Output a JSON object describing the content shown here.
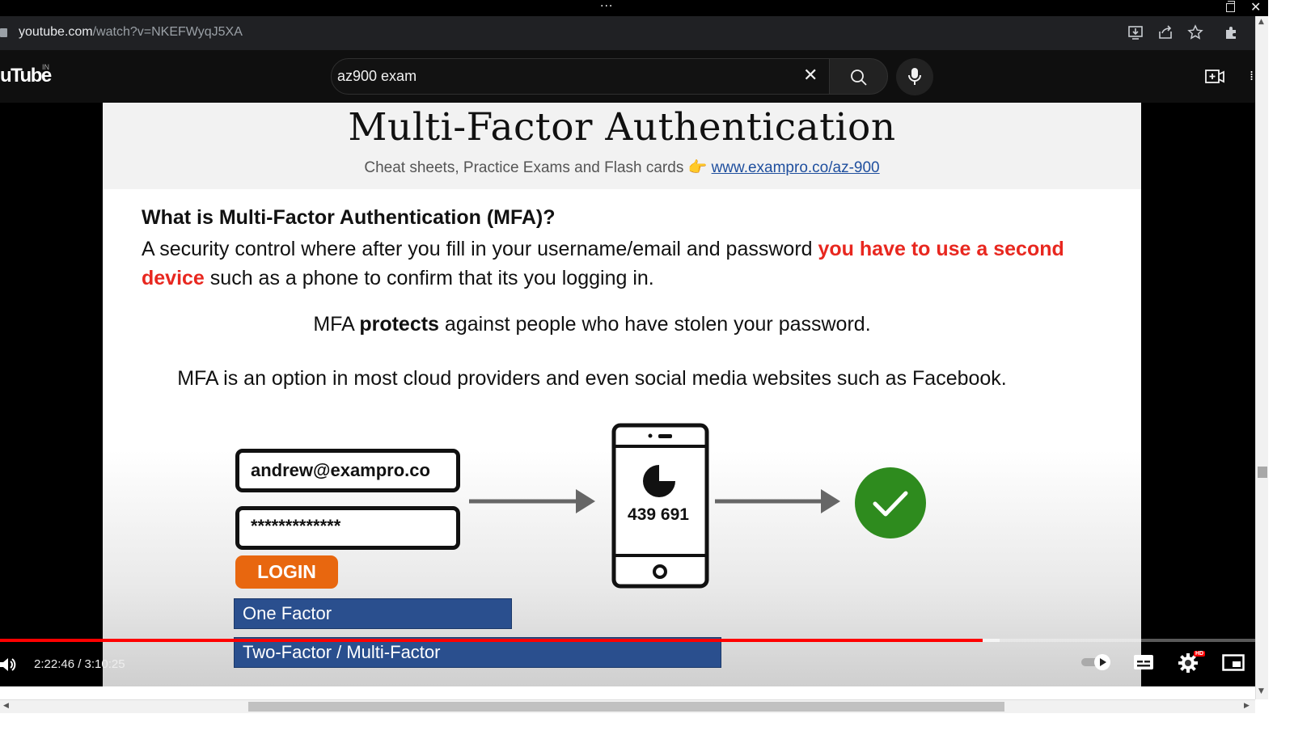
{
  "window": {
    "menu_glyph": "···",
    "close_glyph": "✕"
  },
  "address_bar": {
    "url_host": "youtube.com",
    "url_path": "/watch?v=NKEFWyqJ5XA",
    "icons": [
      "lock-icon",
      "install-icon",
      "share-icon",
      "bookmark-star-icon",
      "extensions-icon"
    ]
  },
  "yt_header": {
    "logo_text": "uTube",
    "region": "IN",
    "search_value": "az900 exam",
    "clear_glyph": "✕",
    "more_glyph": "⁞"
  },
  "slide": {
    "title": "Multi-Factor Authentication",
    "subtitle_text": "Cheat sheets, Practice Exams and Flash cards",
    "subtitle_pointer": "👉",
    "subtitle_link": "www.exampro.co/az-900",
    "question_heading": "What is Multi-Factor Authentication (MFA)?",
    "body_part1": "A security control where after you fill in your username/email and password ",
    "body_red": "you have to use a second device",
    "body_part2": " such as a phone to confirm that its you logging in.",
    "line2_pre": "MFA ",
    "line2_bold": "protects",
    "line2_post": " against people who have stolen your password.",
    "line3": "MFA is an option in most cloud providers and even social media websites such as Facebook.",
    "email_value": "andrew@exampro.co",
    "password_value": "*************",
    "login_label": "LOGIN",
    "phone_code": "439 691",
    "one_factor_label": "One Factor",
    "two_factor_label": "Two-Factor / Multi-Factor",
    "colors": {
      "red": "#e8271f",
      "orange": "#e8670f",
      "blue": "#2a4f8e",
      "green": "#2e8b1e"
    }
  },
  "player": {
    "time_display": "2:22:46 / 3:10:25",
    "progress_fraction": 0.783,
    "hd_badge": "HD",
    "controls": [
      "volume-icon",
      "autoplay-toggle",
      "subtitles-icon",
      "settings-icon",
      "miniplayer-icon"
    ]
  },
  "scrollbars": {
    "up": "▲",
    "down": "▼",
    "left": "◀",
    "right": "▶"
  }
}
